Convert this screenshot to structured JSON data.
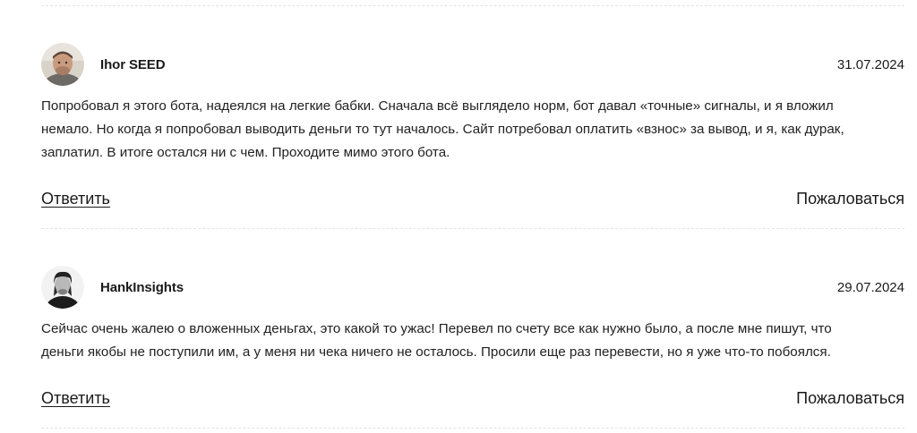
{
  "comments": [
    {
      "author": "Ihor SEED",
      "date": "31.07.2024",
      "avatar_icon": "user-avatar-photo",
      "text_lines": [
        "Попробовал я этого бота, надеялся на легкие бабки. Сначала всё выглядело норм, бот давал «точные» сигналы, и я вложил",
        "немало. Но когда я попробовал выводить деньги то тут началось. Сайт потребовал оплатить «взнос» за вывод, и я, как дурак,",
        "заплатил. В итоге остался ни с чем. Проходите мимо этого бота."
      ],
      "reply_label": "Ответить",
      "report_label": "Пожаловаться"
    },
    {
      "author": "HankInsights",
      "date": "29.07.2024",
      "avatar_icon": "user-avatar-photo",
      "text_lines": [
        "Сейчас очень жалею о вложенных деньгах, это какой то ужас! Перевел по счету все как нужно было, а после мне пишут, что",
        "деньги якобы не поступили им, а у меня ни чека ничего не осталось. Просили еще раз перевести, но я уже что-то побоялся."
      ],
      "reply_label": "Ответить",
      "report_label": "Пожаловаться"
    }
  ],
  "colors": {
    "text": "#1a1a1a",
    "divider": "#e3e3e3",
    "background": "#ffffff"
  }
}
